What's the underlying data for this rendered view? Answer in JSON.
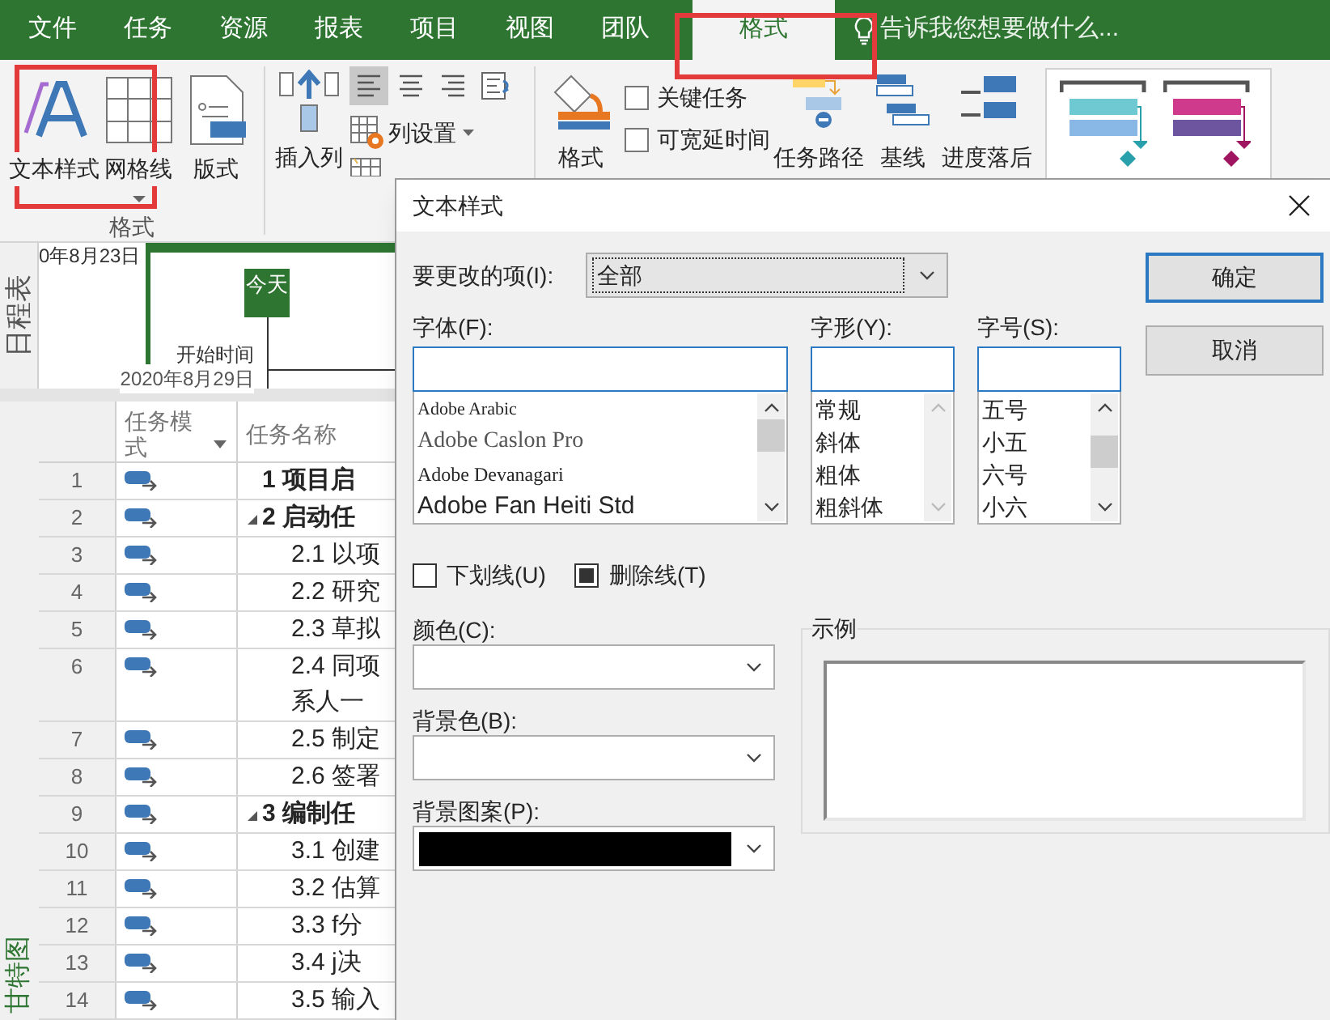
{
  "ribbon_tabs": [
    {
      "label": "文件",
      "selected": false
    },
    {
      "label": "任务",
      "selected": false
    },
    {
      "label": "资源",
      "selected": false
    },
    {
      "label": "报表",
      "selected": false
    },
    {
      "label": "项目",
      "selected": false
    },
    {
      "label": "视图",
      "selected": false
    },
    {
      "label": "团队",
      "selected": false
    },
    {
      "label": "格式",
      "selected": true
    }
  ],
  "tell_me": {
    "placeholder": "告诉我您想要做什么..."
  },
  "ribbon": {
    "format_group": {
      "label": "格式",
      "buttons": [
        {
          "label": "文本样式",
          "kind": "text_style",
          "dropdown": false
        },
        {
          "label": "网格线",
          "kind": "gridlines",
          "dropdown": true
        },
        {
          "label": "版式",
          "kind": "layout",
          "dropdown": false
        }
      ]
    },
    "insert_column": "插入列",
    "align_buttons": [
      {
        "kind": "left",
        "selected": true
      },
      {
        "kind": "center",
        "selected": false
      },
      {
        "kind": "right",
        "selected": false
      }
    ],
    "column_settings": "列设置",
    "format_button": "格式",
    "checkboxes": [
      {
        "label": "关键任务",
        "checked": false
      },
      {
        "label": "可宽延时间",
        "checked": false
      }
    ],
    "bar_buttons": [
      {
        "label": "任务路径",
        "kind": "task_path"
      },
      {
        "label": "基线",
        "kind": "baseline"
      },
      {
        "label": "进度落后",
        "kind": "slippage"
      }
    ]
  },
  "timeline": {
    "view_label": "日程表",
    "start_date_cut": "0年8月23日",
    "today": "今天",
    "start_caption": "开始时间",
    "start_date": "2020年8月29日"
  },
  "gantt_view_label": "甘特图",
  "table": {
    "columns": [
      "任务模式",
      "任务名称"
    ],
    "rows": [
      {
        "id": "1",
        "name": "1 项目启",
        "kind": "summary",
        "expanded": false
      },
      {
        "id": "2",
        "name": "2 启动任",
        "kind": "summary",
        "expanded": true
      },
      {
        "id": "3",
        "name": "2.1 以项",
        "kind": "task",
        "expanded": false
      },
      {
        "id": "4",
        "name": "2.2 研究",
        "kind": "task",
        "expanded": false
      },
      {
        "id": "5",
        "name": "2.3 草拟",
        "kind": "task",
        "expanded": false
      },
      {
        "id": "6",
        "name": "2.4 同项",
        "continuation": "系人一",
        "kind": "task",
        "expanded": false
      },
      {
        "id": "7",
        "name": "2.5 制定",
        "kind": "task",
        "expanded": false
      },
      {
        "id": "8",
        "name": "2.6 签署",
        "kind": "task",
        "expanded": false
      },
      {
        "id": "9",
        "name": "3 编制任",
        "kind": "summary",
        "expanded": true
      },
      {
        "id": "10",
        "name": "3.1 创建",
        "kind": "task",
        "expanded": false
      },
      {
        "id": "11",
        "name": "3.2 估算",
        "kind": "task",
        "expanded": false
      },
      {
        "id": "12",
        "name": "3.3 f分",
        "kind": "task",
        "expanded": false
      },
      {
        "id": "13",
        "name": "3.4 j决",
        "kind": "task",
        "expanded": false
      },
      {
        "id": "14",
        "name": "3.5 输入",
        "kind": "task",
        "expanded": false
      }
    ]
  },
  "dialog": {
    "title": "文本样式",
    "item_label": "要更改的项(I):",
    "item_value": "全部",
    "font": {
      "label": "字体(F):",
      "items": [
        "Adobe Arabic",
        "Adobe Caslon Pro",
        "Adobe Devanagari",
        "Adobe Fan Heiti Std"
      ]
    },
    "style": {
      "label": "字形(Y):",
      "items": [
        "常规",
        "斜体",
        "粗体",
        "粗斜体"
      ]
    },
    "size": {
      "label": "字号(S):",
      "items": [
        "五号",
        "小五",
        "六号",
        "小六"
      ]
    },
    "checkboxes": [
      {
        "label": "下划线(U)",
        "checked": false,
        "indeterminate": false
      },
      {
        "label": "删除线(T)",
        "checked": false,
        "indeterminate": true
      }
    ],
    "dropdowns": [
      {
        "label": "颜色(C):"
      },
      {
        "label": "背景色(B):"
      },
      {
        "label": "背景图案(P):",
        "color": "#000000"
      }
    ],
    "sample_label": "示例",
    "buttons": [
      {
        "label": "确定",
        "default": true
      },
      {
        "label": "取消",
        "default": false
      }
    ]
  }
}
